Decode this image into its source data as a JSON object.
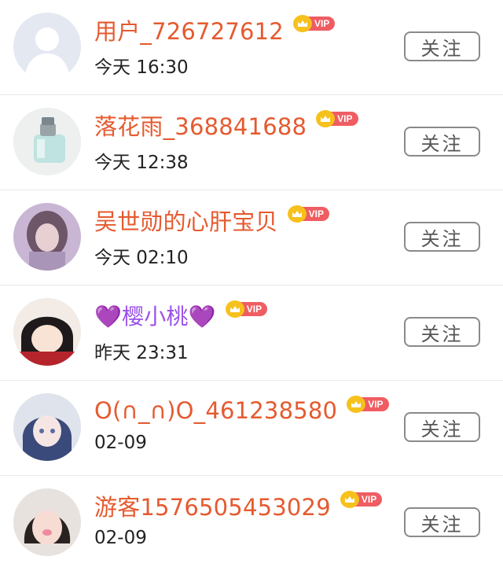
{
  "follow_label": "关注",
  "vip_label": "VIP",
  "users": [
    {
      "name": "用户_726727612",
      "time": "今天 16:30",
      "avatar": "default-user-avatar"
    },
    {
      "name": "落花雨_368841688",
      "time": "今天 12:38",
      "avatar": "perfume-bottle-avatar"
    },
    {
      "name": "吴世勋的心肝宝贝",
      "time": "今天 02:10",
      "avatar": "girl-photo-avatar"
    },
    {
      "name": "💜樱小桃💜",
      "time": "昨天 23:31",
      "avatar": "anime-girl-avatar"
    },
    {
      "name": "O(∩_∩)O_461238580",
      "time": "02-09",
      "avatar": "anime-blue-hair-avatar"
    },
    {
      "name": "游客1576505453029",
      "time": "02-09",
      "avatar": "girl-selfie-avatar"
    }
  ],
  "colors": {
    "name": "#e55a2f",
    "vip_tag": "#ef5d62",
    "crown": "#f6c11c",
    "heart": "#9b52e8"
  }
}
